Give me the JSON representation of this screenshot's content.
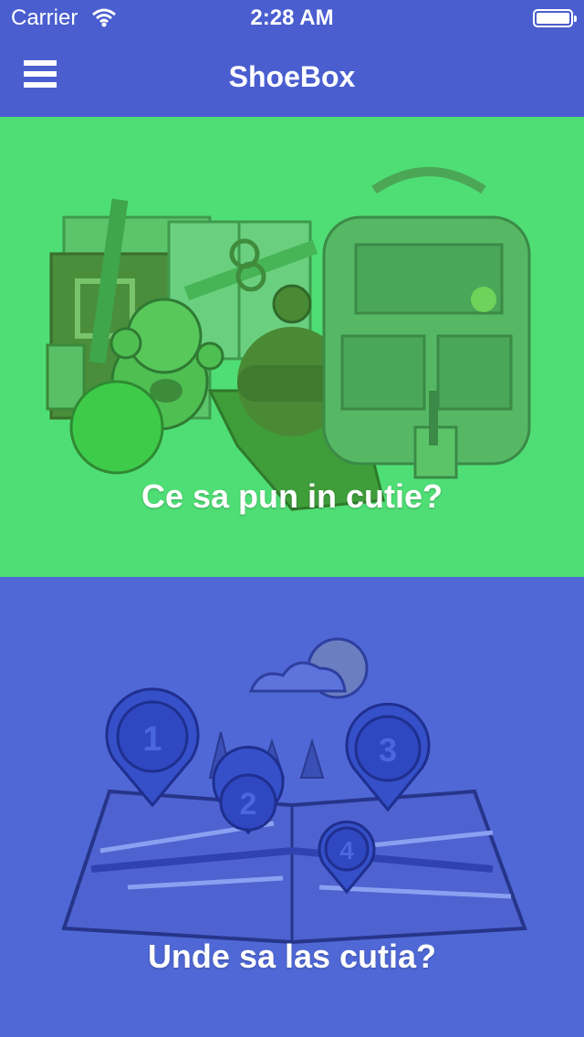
{
  "status_bar": {
    "carrier": "Carrier",
    "time": "2:28 AM",
    "battery_level": 1.0
  },
  "nav": {
    "title": "ShoeBox",
    "menu_icon": "hamburger-menu-icon"
  },
  "panels": [
    {
      "caption": "Ce sa pun in cutie?",
      "illustration": "school-supplies-bear-hat-backpack",
      "color": "#4fde75"
    },
    {
      "caption": "Unde sa las cutia?",
      "illustration": "map-with-numbered-pins",
      "color": "#5068d6",
      "pins": [
        "1",
        "2",
        "3",
        "4"
      ]
    }
  ],
  "colors": {
    "nav": "#4a5ecf",
    "green": "#4fde75",
    "blue": "#5068d6"
  }
}
